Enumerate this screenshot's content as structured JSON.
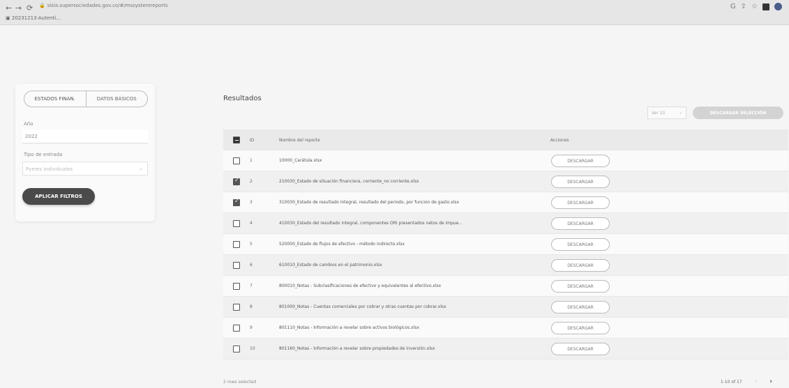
{
  "browser": {
    "url": "sisia.supersociedades.gov.co/#/mssystemreports",
    "bookmark": "20231213-Autenti..."
  },
  "filters": {
    "toggle_estados": "ESTADOS FINAN.",
    "toggle_datos": "DATOS BÁSICOS",
    "anio_label": "Año",
    "anio_value": "2022",
    "tipo_label": "Tipo de entrada",
    "tipo_value": "Pymes individuales",
    "apply_label": "APLICAR FILTROS"
  },
  "results": {
    "title": "Resultados",
    "ver_value": "Ver 10",
    "download_selection": "DESCARGAR SELECCIÓN",
    "header": {
      "id": "ID",
      "name": "Nombre del reporte",
      "actions": "Acciones"
    },
    "download_label": "DESCARGAR",
    "rows": [
      {
        "id": "1",
        "name": "10000_Carátula.xlsx",
        "checked": false
      },
      {
        "id": "2",
        "name": "210030_Estado de situación financiera, corriente_no corriente.xlsx",
        "checked": true
      },
      {
        "id": "3",
        "name": "310030_Estado de resultado integral, resultado del periodo, por funcion de gasto.xlsx",
        "checked": true
      },
      {
        "id": "4",
        "name": "410030_Estado del resultado integral, componentes ORI presentados netos de impue...",
        "checked": false
      },
      {
        "id": "5",
        "name": "520000_Estado de flujos de efectivo - método indirecto.xlsx",
        "checked": false
      },
      {
        "id": "6",
        "name": "610010_Estado de cambios en el patrimonio.xlsx",
        "checked": false
      },
      {
        "id": "7",
        "name": "800010_Notas - Subclasificaciones de efectivo y equivalentes al efectivo.xlsx",
        "checked": false
      },
      {
        "id": "8",
        "name": "801000_Notas - Cuentas comerciales por cobrar y otras cuentas por cobrar.xlsx",
        "checked": false
      },
      {
        "id": "9",
        "name": "801110_Notas - Información a revelar sobre activos biológicos.xlsx",
        "checked": false
      },
      {
        "id": "10",
        "name": "801160_Notas - Información a revelar sobre propiedades de inversión.xlsx",
        "checked": false
      }
    ],
    "selected_text": "2 rows selected",
    "range_text": "1-10 of 17"
  }
}
